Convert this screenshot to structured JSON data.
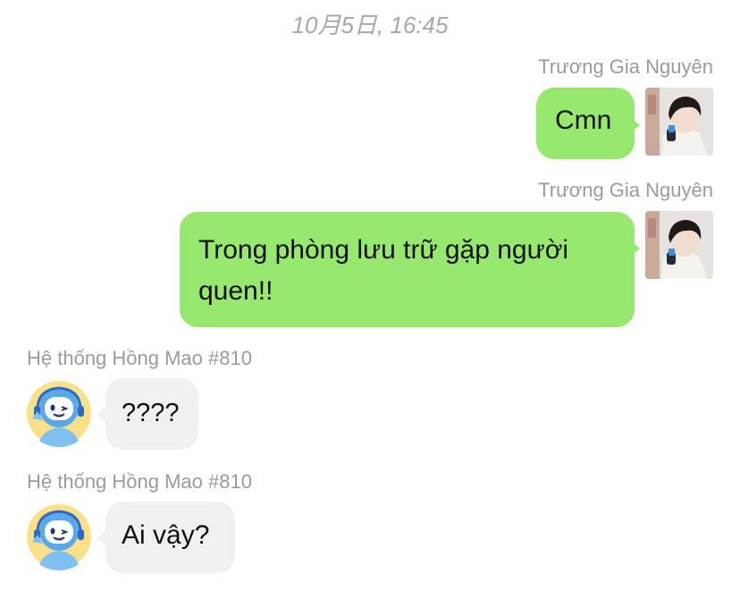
{
  "chat": {
    "timestamp": "10月5日, 16:45",
    "colors": {
      "outgoing_bubble": "#97e86e",
      "incoming_bubble": "#f0f0f0",
      "name_text": "#9b9b9b",
      "timestamp_text": "#a8a8a8"
    },
    "messages": [
      {
        "sender": "Trương Gia Nguyên",
        "direction": "outgoing",
        "avatar": "user-photo-avatar",
        "text": "Cmn"
      },
      {
        "sender": "Trương Gia Nguyên",
        "direction": "outgoing",
        "avatar": "user-photo-avatar",
        "text": "Trong phòng lưu trữ gặp người quen!!"
      },
      {
        "sender": "Hệ thống Hồng Mao #810",
        "direction": "incoming",
        "avatar": "robot-mascot-avatar",
        "text": "????"
      },
      {
        "sender": "Hệ thống Hồng Mao #810",
        "direction": "incoming",
        "avatar": "robot-mascot-avatar",
        "text": "Ai vậy?"
      }
    ]
  }
}
